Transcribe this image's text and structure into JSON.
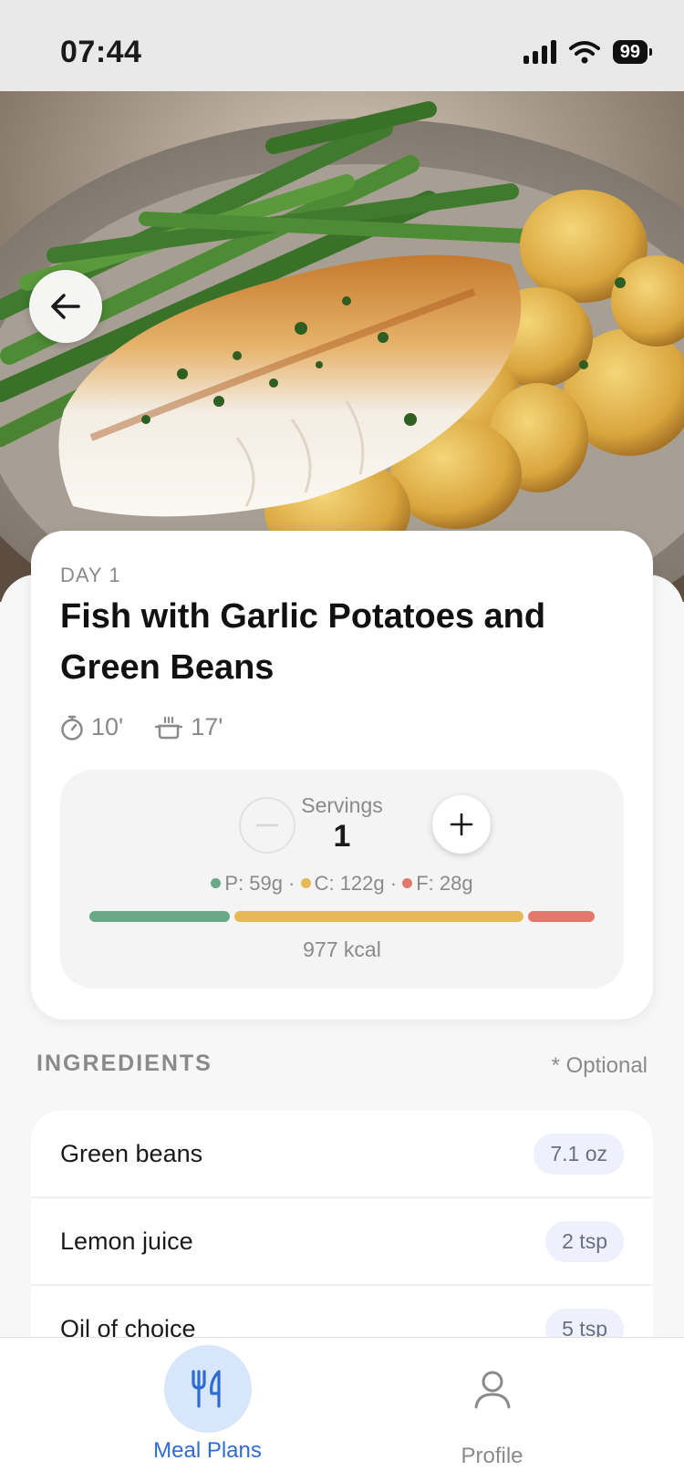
{
  "status_bar": {
    "time": "07:44",
    "battery": "99"
  },
  "recipe": {
    "day": "DAY 1",
    "title": "Fish with Garlic Potatoes and Green Beans",
    "prep_time": "10'",
    "cook_time": "17'"
  },
  "servings": {
    "label": "Servings",
    "value": "1"
  },
  "macros": {
    "protein": "P: 59g",
    "carbs": "C: 122g",
    "fat": "F: 28g",
    "protein_value": 59,
    "carbs_value": 122,
    "fat_value": 28,
    "kcal": "977 kcal",
    "colors": {
      "protein": "#6aa987",
      "carbs": "#e6b857",
      "fat": "#e0796a"
    }
  },
  "ingredients": {
    "title": "INGREDIENTS",
    "optional_note": "* Optional",
    "items": [
      {
        "name": "Green beans",
        "qty": "7.1 oz"
      },
      {
        "name": "Lemon juice",
        "qty": "2 tsp"
      },
      {
        "name": "Oil of choice",
        "qty": "5 tsp"
      }
    ]
  },
  "tabs": [
    {
      "label": "Meal Plans",
      "icon": "fork-knife-icon",
      "active": true
    },
    {
      "label": "Profile",
      "icon": "person-icon",
      "active": false
    }
  ],
  "colors": {
    "accent": "#2f6cd1"
  }
}
